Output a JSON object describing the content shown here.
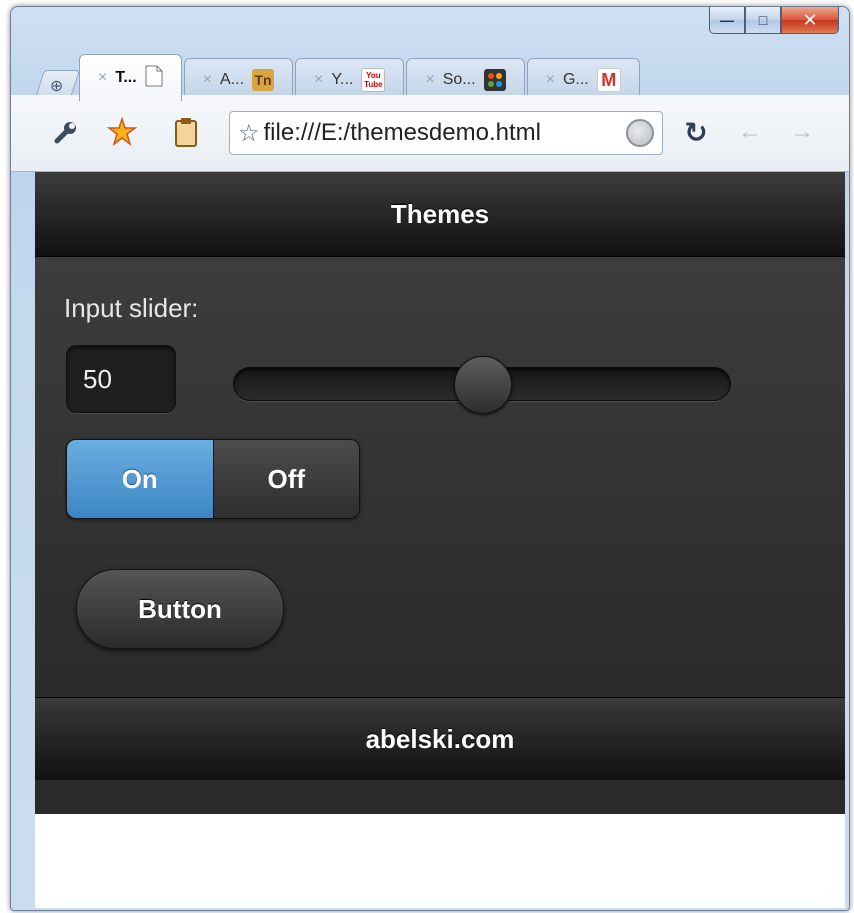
{
  "browser": {
    "tabs": [
      {
        "label": "T...",
        "icon": "page-icon",
        "active": true
      },
      {
        "label": "A...",
        "icon": "tn-favicon"
      },
      {
        "label": "Y...",
        "icon": "youtube-favicon",
        "favicon_text": "You Tube"
      },
      {
        "label": "So...",
        "icon": "joomla-favicon"
      },
      {
        "label": "G...",
        "icon": "gmail-favicon",
        "favicon_text": "M"
      }
    ],
    "address": "file:///E:/themesdemo.html",
    "caption": {
      "minimize": "—",
      "maximize": "□",
      "close": "✕"
    },
    "new_tab_symbol": "⊕"
  },
  "page": {
    "header_title": "Themes",
    "slider_label": "Input slider:",
    "slider_value": "50",
    "slider_fraction": 0.5,
    "flip_on": "On",
    "flip_off": "Off",
    "flip_state": "on",
    "button_label": "Button",
    "footer_text": "abelski.com"
  },
  "colors": {
    "accent_on": "#3c86c4",
    "bar_dark": "#111111",
    "body_dark": "#333333"
  }
}
